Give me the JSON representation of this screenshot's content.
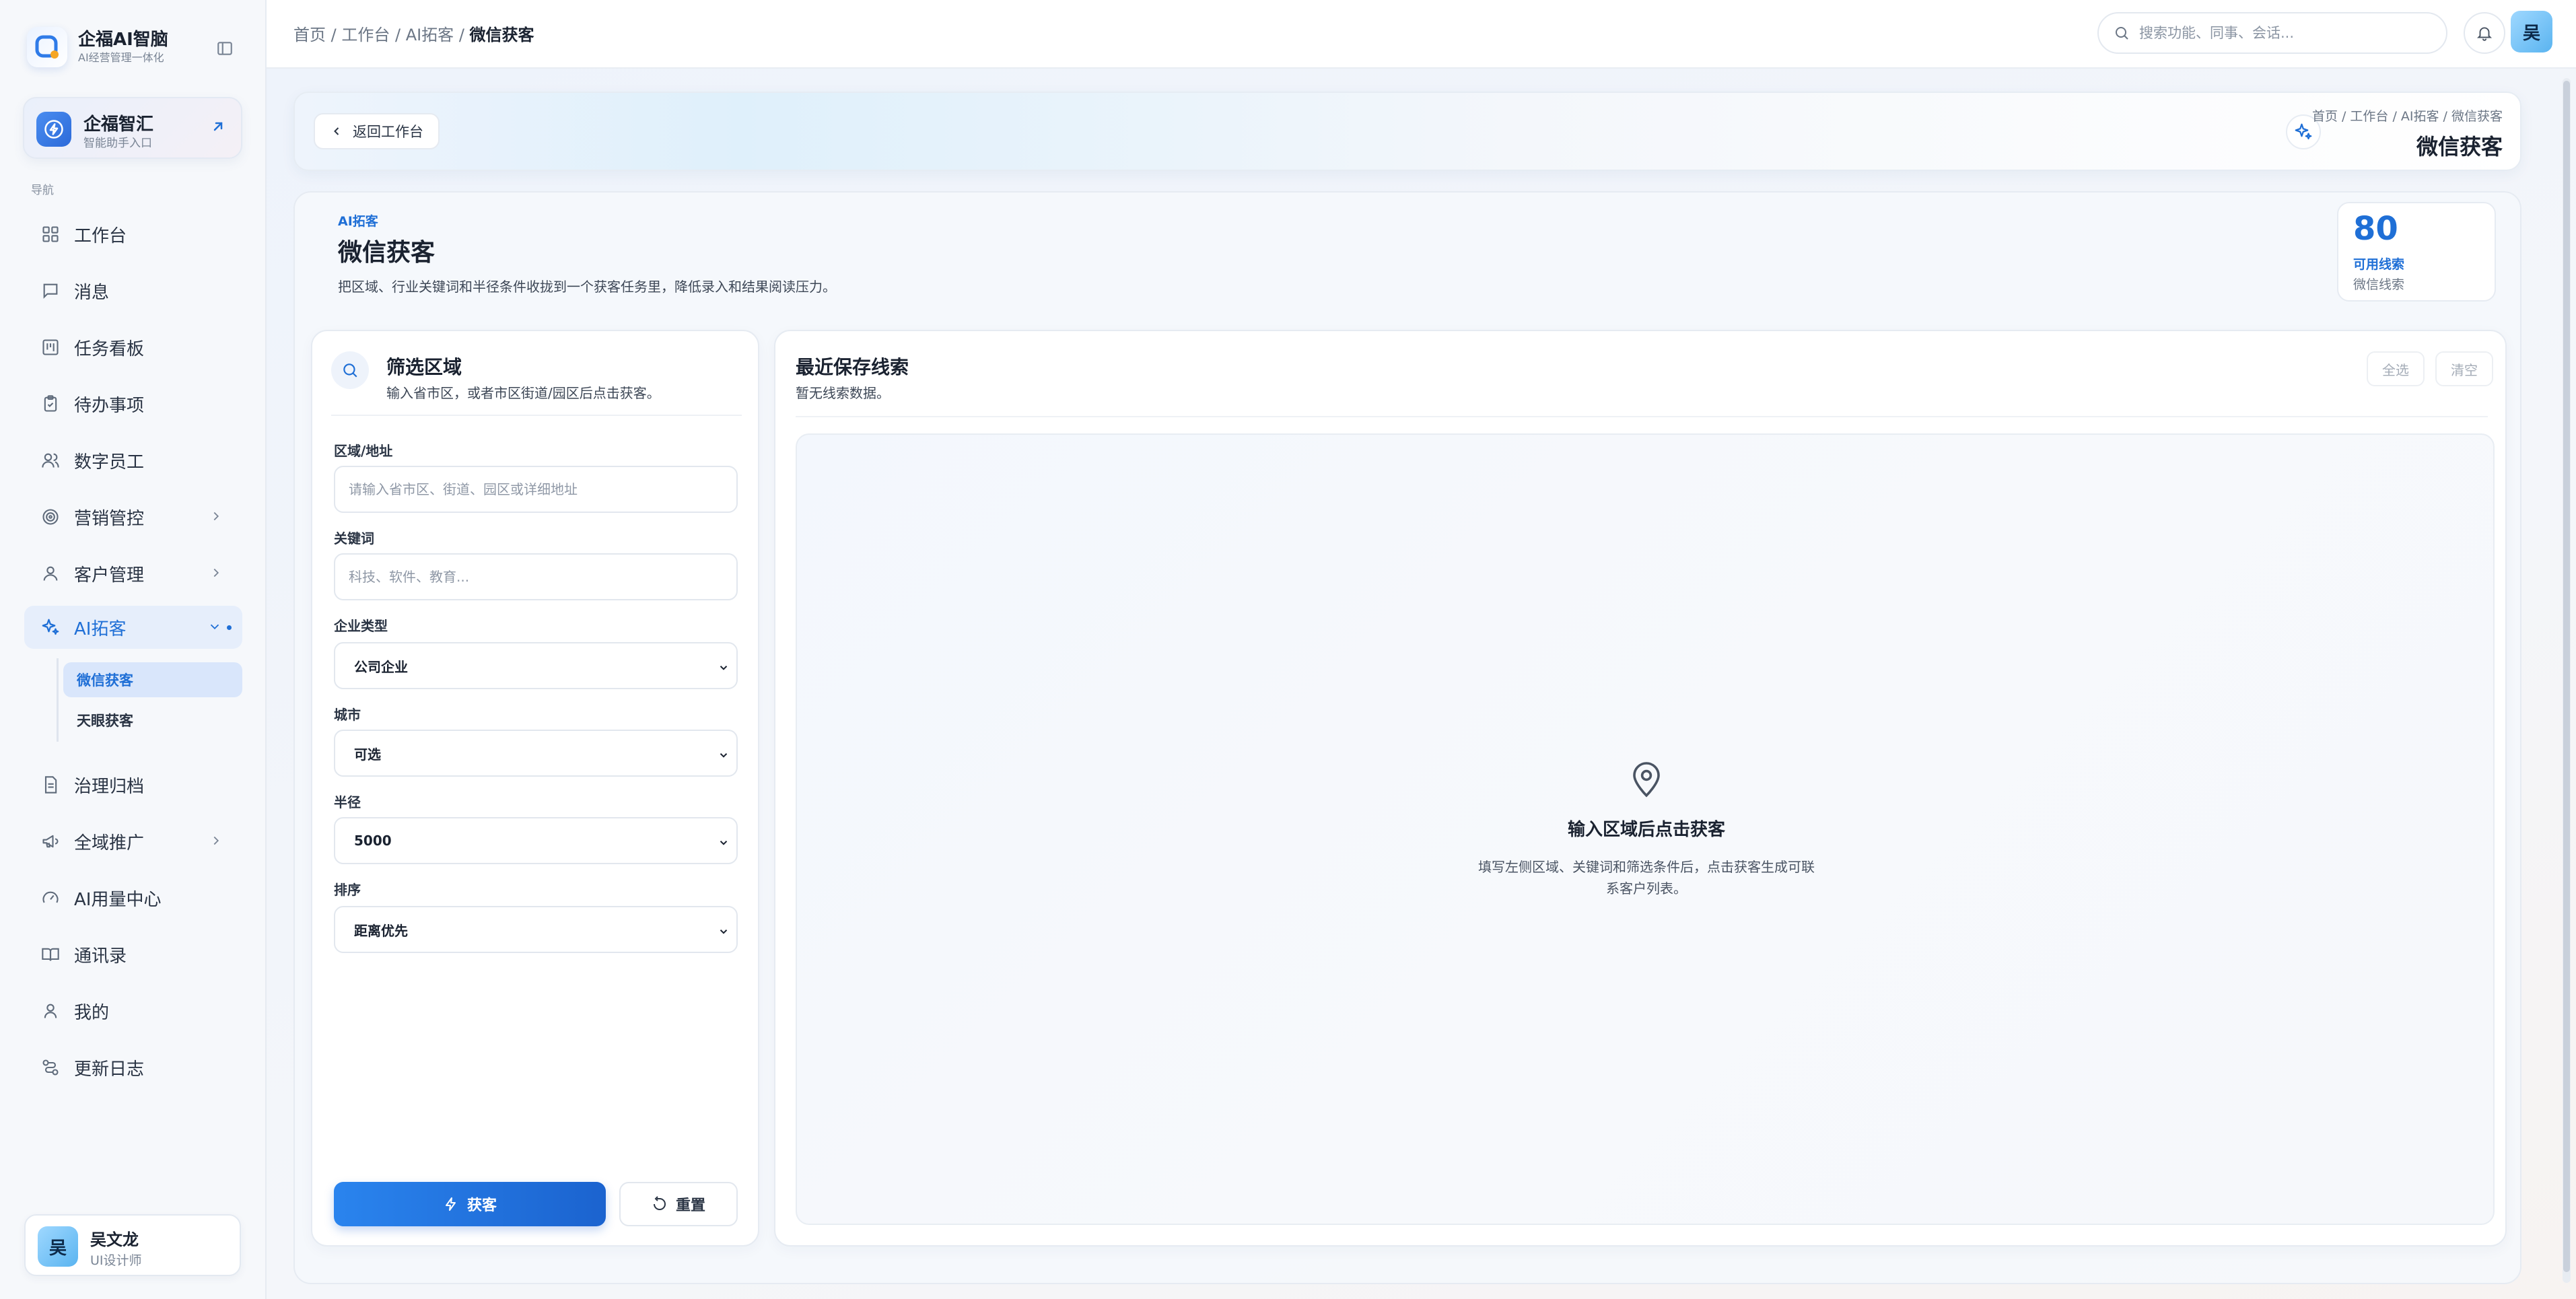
{
  "brand": {
    "name": "企福AI智脑",
    "subtitle": "AI经营管理一体化"
  },
  "promo": {
    "title": "企福智汇",
    "subtitle": "智能助手入口"
  },
  "nav": {
    "section_label": "导航",
    "items": [
      {
        "label": "工作台",
        "icon": "grid-icon"
      },
      {
        "label": "消息",
        "icon": "message-icon"
      },
      {
        "label": "任务看板",
        "icon": "kanban-icon"
      },
      {
        "label": "待办事项",
        "icon": "clipboard-icon"
      },
      {
        "label": "数字员工",
        "icon": "users-icon"
      },
      {
        "label": "营销管控",
        "icon": "target-icon"
      },
      {
        "label": "客户管理",
        "icon": "user-icon"
      },
      {
        "label": "AI拓客",
        "icon": "sparkles-icon"
      },
      {
        "label": "治理归档",
        "icon": "file-icon"
      },
      {
        "label": "全域推广",
        "icon": "megaphone-icon"
      },
      {
        "label": "AI用量中心",
        "icon": "gauge-icon"
      },
      {
        "label": "通讯录",
        "icon": "book-icon"
      },
      {
        "label": "我的",
        "icon": "person-icon"
      },
      {
        "label": "更新日志",
        "icon": "route-icon"
      }
    ],
    "sub_items": [
      {
        "label": "微信获客"
      },
      {
        "label": "天眼获客"
      }
    ]
  },
  "user": {
    "avatar": "吴",
    "name": "吴文龙",
    "role": "UI设计师"
  },
  "topbar": {
    "breadcrumb": [
      "首页",
      "工作台",
      "AI拓客"
    ],
    "breadcrumb_sep": " / ",
    "breadcrumb_current": "微信获客",
    "search_placeholder": "搜索功能、同事、会话..."
  },
  "hero": {
    "back_label": "返回工作台",
    "breadcrumb": "首页 / 工作台 / AI拓客 / 微信获客",
    "title": "微信获客"
  },
  "intro": {
    "tag": "AI拓客",
    "title": "微信获客",
    "desc": "把区域、行业关键词和半径条件收拢到一个获客任务里，降低录入和结果阅读压力。",
    "stat": {
      "value": "80",
      "label": "可用线索",
      "sub": "微信线索"
    }
  },
  "filter": {
    "title": "筛选区域",
    "subtitle": "输入省市区，或者市区街道/园区后点击获客。",
    "fields": {
      "area": {
        "label": "区域/地址",
        "placeholder": "请输入省市区、街道、园区或详细地址"
      },
      "keyword": {
        "label": "关键词",
        "placeholder": "科技、软件、教育..."
      },
      "company_type": {
        "label": "企业类型",
        "value": "公司企业"
      },
      "city": {
        "label": "城市",
        "value": "可选"
      },
      "radius": {
        "label": "半径",
        "value": "5000"
      },
      "sort": {
        "label": "排序",
        "value": "距离优先"
      }
    },
    "submit_label": "获客",
    "reset_label": "重置"
  },
  "leads": {
    "title": "最近保存线索",
    "subtitle": "暂无线索数据。",
    "select_all_label": "全选",
    "clear_label": "清空",
    "empty_title": "输入区域后点击获客",
    "empty_desc": "填写左侧区域、关键词和筛选条件后，点击获客生成可联系客户列表。"
  },
  "colors": {
    "accent": "#1f6fd6",
    "primary_button": "#2a84ee",
    "avatar": "#7cc7f6"
  }
}
